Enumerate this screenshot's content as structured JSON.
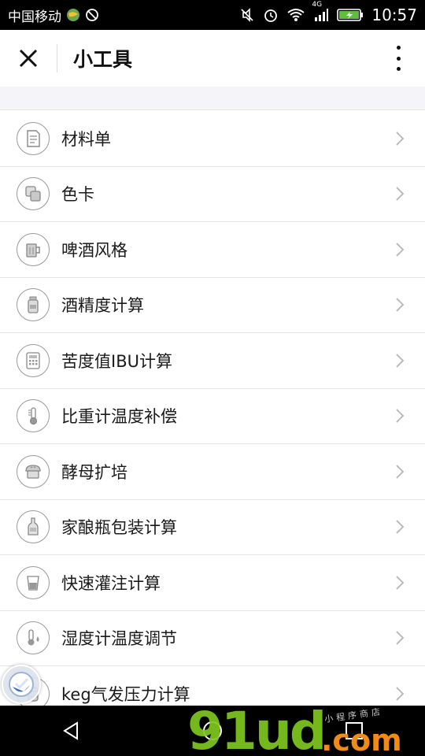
{
  "status_bar": {
    "carrier": "中国移动",
    "network": "4G",
    "time": "10:57"
  },
  "header": {
    "title": "小工具"
  },
  "items": [
    {
      "label": "材料单",
      "icon": "document-icon"
    },
    {
      "label": "色卡",
      "icon": "color-swatch-icon"
    },
    {
      "label": "啤酒风格",
      "icon": "beer-mug-icon"
    },
    {
      "label": "酒精度计算",
      "icon": "bottle-icon"
    },
    {
      "label": "苦度值IBU计算",
      "icon": "calculator-icon"
    },
    {
      "label": "比重计温度补偿",
      "icon": "thermometer-icon"
    },
    {
      "label": "酵母扩培",
      "icon": "yeast-icon"
    },
    {
      "label": "家酿瓶包装计算",
      "icon": "beer-bottle-icon"
    },
    {
      "label": "快速灌注计算",
      "icon": "cup-icon"
    },
    {
      "label": "湿度计温度调节",
      "icon": "thermometer-drop-icon"
    },
    {
      "label": "keg气发压力计算",
      "icon": "keg-icon"
    }
  ],
  "watermark": {
    "main": "91ud",
    "com": ".com",
    "small": "小程序商店"
  }
}
